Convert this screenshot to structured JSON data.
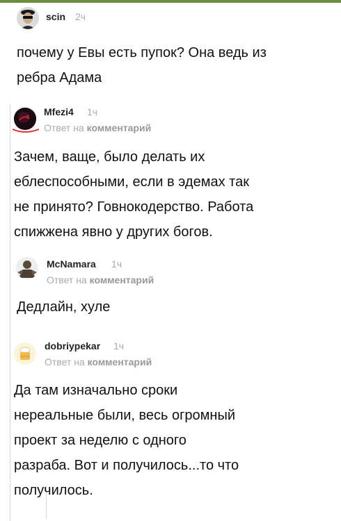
{
  "comments": [
    {
      "username": "scin",
      "time": "2ч",
      "reply_prefix": "",
      "reply_target": "",
      "text_lines": [
        "почему у Евы есть пупок? Она ведь из",
        "ребра Адама"
      ],
      "avatar_icon": "sunglasses-man-avatar-icon"
    },
    {
      "username": "Mfezi4",
      "time": "1ч",
      "reply_prefix": "Ответ на",
      "reply_target": "комментарий",
      "text_lines": [
        "Зачем, ваще, было делать их",
        "еблеспособными, если в эдемах так",
        "не принято? Говнокодерство. Работа",
        "спижжена явно у других богов."
      ],
      "avatar_icon": "dark-red-avatar-icon"
    },
    {
      "username": "McNamara",
      "time": "1ч",
      "reply_prefix": "Ответ на",
      "reply_target": "комментарий",
      "text_lines": [
        "Дедлайн, хуле"
      ],
      "avatar_icon": "warrior-avatar-icon"
    },
    {
      "username": "dobriypekar",
      "time": "1ч",
      "reply_prefix": "Ответ на",
      "reply_target": "комментарий",
      "text_lines": [
        "Да там изначально сроки",
        "нереальные были, весь огромный",
        "проект за неделю с одного",
        "разраба. Вот и получилось...то что",
        "получилось."
      ],
      "avatar_icon": "baker-avatar-icon"
    }
  ],
  "colors": {
    "accent_bar": "#6b8e3d",
    "meta_text": "#aaaaaa",
    "body_text": "#111111"
  }
}
